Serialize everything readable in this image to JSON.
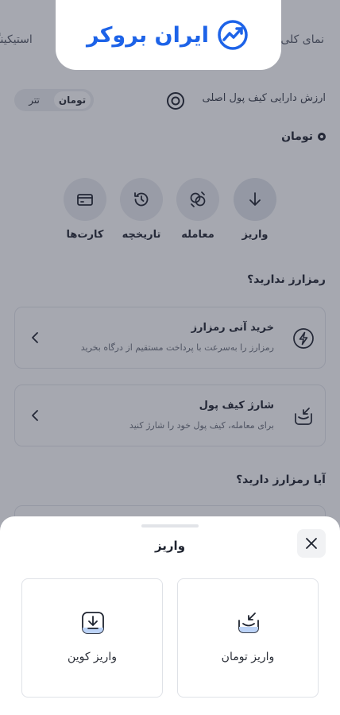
{
  "header": {
    "logo_text": "ایران بروکر",
    "tabs": [
      {
        "label": "نمای کلی"
      },
      {
        "label": "استیکینگ"
      }
    ]
  },
  "balance": {
    "label": "ارزش دارایی کیف پول اصلی",
    "toggle": {
      "toman": "تومان",
      "tether": "تتر"
    },
    "currency": "تومان"
  },
  "actions": {
    "deposit": "واریز",
    "trade": "معامله",
    "history": "تاریخچه",
    "cards": "کارت‌ها"
  },
  "no_crypto": {
    "title": "رمزارز ندارید؟",
    "cards": [
      {
        "title": "خرید آنی رمزارز",
        "subtitle": "رمزارز را به‌سرعت با پرداخت مستقیم از درگاه بخرید"
      },
      {
        "title": "شارژ کیف پول",
        "subtitle": "برای معامله، کیف پول خود را شارژ کنید"
      }
    ]
  },
  "have_crypto": {
    "title": "آیا رمزارز دارید؟"
  },
  "sheet": {
    "title": "واریز",
    "options": [
      {
        "label": "واریز تومان",
        "icon": "wallet-charge-icon"
      },
      {
        "label": "واریز کوین",
        "icon": "coin-deposit-icon"
      }
    ]
  },
  "colors": {
    "brand": "#1d63e8",
    "overlay": "#2a3042"
  }
}
